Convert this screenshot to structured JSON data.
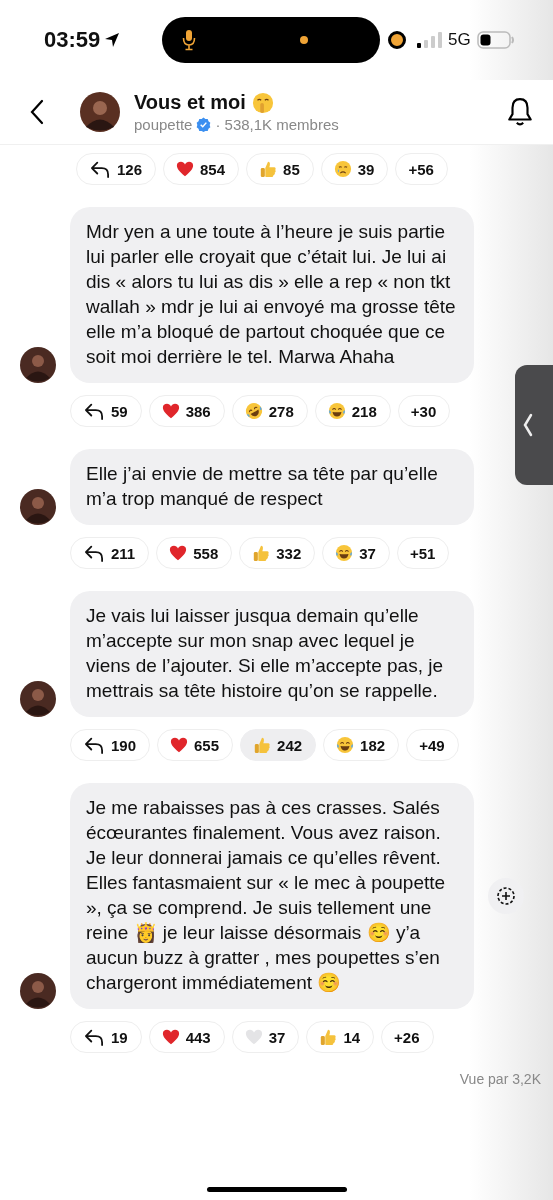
{
  "status_bar": {
    "time": "03:59",
    "network": "5G"
  },
  "header": {
    "title": "Vous et moi",
    "author": "poupette",
    "verified": true,
    "members": "· 538,1K membres"
  },
  "top_reactions": {
    "replies": "126",
    "more": "+56",
    "reactions": [
      {
        "kind": "heart",
        "count": "854",
        "selected": false
      },
      {
        "kind": "thumbs-up",
        "count": "85",
        "selected": false
      },
      {
        "kind": "crying",
        "count": "39",
        "selected": false
      }
    ]
  },
  "messages": [
    {
      "text": "Mdr yen a une toute à l’heure je suis partie  lui parler elle croyait que c’était lui. Je lui ai dis «  alors tu lui as dis » elle a rep «  non tkt wallah » mdr je lui ai envoyé ma grosse tête elle m’a bloqué de partout choquée que ce soit moi derrière le tel. Marwa Ahaha",
      "replies": "59",
      "more": "+30",
      "add_button": false,
      "reactions": [
        {
          "kind": "heart",
          "count": "386",
          "selected": false
        },
        {
          "kind": "rofl",
          "count": "278",
          "selected": false
        },
        {
          "kind": "joy",
          "count": "218",
          "selected": false
        }
      ]
    },
    {
      "text": "Elle j’ai envie de mettre sa tête par qu’elle m’a trop manqué de respect",
      "replies": "211",
      "more": "+51",
      "add_button": false,
      "reactions": [
        {
          "kind": "heart",
          "count": "558",
          "selected": false
        },
        {
          "kind": "thumbs-up",
          "count": "332",
          "selected": false
        },
        {
          "kind": "joy",
          "count": "37",
          "selected": false
        }
      ]
    },
    {
      "text": "Je vais lui laisser jusqua  demain qu’elle m’accepte sur mon snap avec lequel je viens de l’ajouter. Si elle m’accepte pas, je mettrais sa tête histoire qu’on se rappelle.",
      "replies": "190",
      "more": "+49",
      "add_button": false,
      "reactions": [
        {
          "kind": "heart",
          "count": "655",
          "selected": false
        },
        {
          "kind": "thumbs-up",
          "count": "242",
          "selected": true
        },
        {
          "kind": "joy",
          "count": "182",
          "selected": false
        }
      ]
    },
    {
      "text": "Je me rabaisses pas à ces crasses. Salés écœurantes finalement. Vous avez raison. Je leur donnerai jamais ce qu’elles rêvent. Elles fantasmaient sur « le mec à poupette », ça se comprend. Je suis tellement une reine 👸 je leur laisse désormais ☺️ y’a aucun buzz à gratter , mes poupettes s’en chargeront immédiatement ☺️",
      "replies": "19",
      "more": "+26",
      "add_button": true,
      "reactions": [
        {
          "kind": "heart",
          "count": "443",
          "selected": false
        },
        {
          "kind": "white-heart",
          "count": "37",
          "selected": false
        },
        {
          "kind": "thumbs-up",
          "count": "14",
          "selected": false
        }
      ]
    }
  ],
  "seen": "Vue par 3,2K"
}
